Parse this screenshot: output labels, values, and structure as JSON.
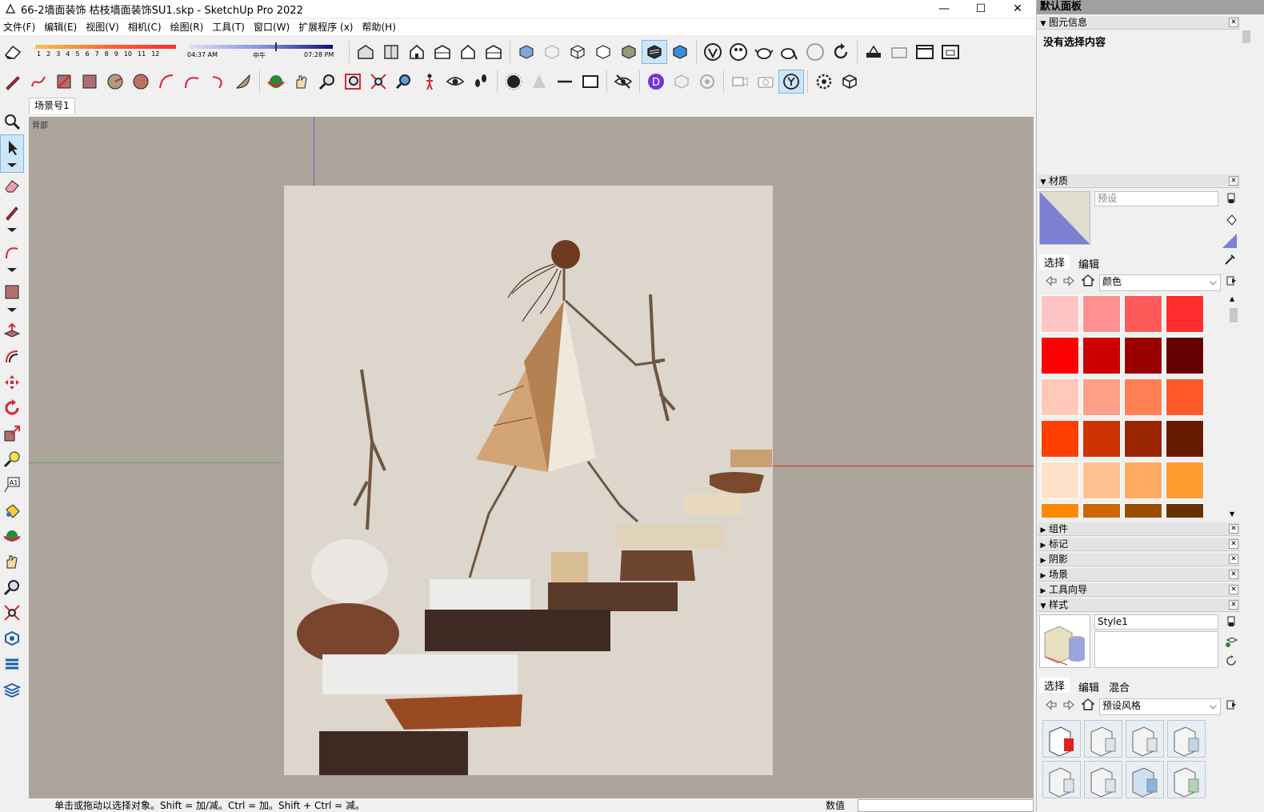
{
  "window": {
    "title": "66-2墙面装饰 枯枝墙面装饰SU1.skp - SketchUp Pro 2022",
    "minimize": "—",
    "maximize": "☐",
    "close": "✕"
  },
  "menu": [
    "文件(F)",
    "编辑(E)",
    "视图(V)",
    "相机(C)",
    "绘图(R)",
    "工具(T)",
    "窗口(W)",
    "扩展程序 (x)",
    "帮助(H)"
  ],
  "shadows": {
    "months": [
      "1",
      "2",
      "3",
      "4",
      "5",
      "6",
      "7",
      "8",
      "9",
      "10",
      "11",
      "12"
    ],
    "time_start": "04:37 AM",
    "time_mid": "中午",
    "time_end": "07:28 PM"
  },
  "scene_tab": "场景号1",
  "viewport": {
    "view_label": "背部",
    "background_color": "#ada59c",
    "artboard_color": "#ddd6cd"
  },
  "statusbar": {
    "message": "单击或拖动以选择对象。Shift = 加/减。Ctrl = 加。Shift + Ctrl = 减。",
    "value_label": "数值"
  },
  "tray": {
    "title": "默认面板",
    "entity_info": {
      "header": "图元信息",
      "content": "没有选择内容"
    },
    "materials": {
      "header": "材质",
      "name_placeholder": "预设",
      "tab_select": "选择",
      "tab_edit": "编辑",
      "collection": "颜色",
      "swatches": [
        "#ffc4c4",
        "#ff9090",
        "#ff5a5a",
        "#ff2e2e",
        "#ff0000",
        "#cc0000",
        "#990000",
        "#660000",
        "#ffc8b8",
        "#ffa088",
        "#ff8055",
        "#ff5a2a",
        "#ff4000",
        "#cc3300",
        "#992600",
        "#661a00",
        "#ffe0c8",
        "#ffc090",
        "#ffaa60",
        "#ff9a30",
        "#ff8800",
        "#cc6600",
        "#994d00",
        "#663300"
      ]
    },
    "collapsed": [
      "组件",
      "标记",
      "阴影",
      "场景",
      "工具向导"
    ],
    "styles": {
      "header": "样式",
      "name": "Style1",
      "tab_select": "选择",
      "tab_edit": "编辑",
      "tab_mix": "混合",
      "collection": "预设风格"
    }
  }
}
